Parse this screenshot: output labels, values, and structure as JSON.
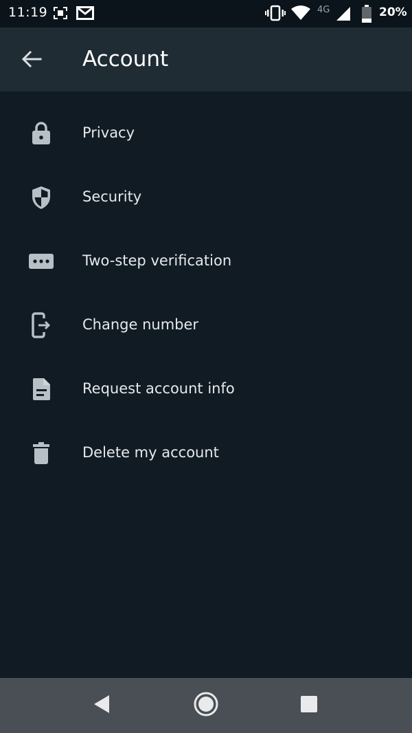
{
  "status_bar": {
    "time": "11:19",
    "network_type": "4G",
    "battery_percent": "20%",
    "icons": [
      "screenshot-icon",
      "gmail-icon",
      "vibrate-icon",
      "wifi-icon",
      "signal-icon",
      "battery-icon"
    ]
  },
  "app_bar": {
    "title": "Account",
    "back_icon": "arrow-left-icon"
  },
  "menu": {
    "items": [
      {
        "label": "Privacy",
        "icon": "lock-icon"
      },
      {
        "label": "Security",
        "icon": "shield-icon"
      },
      {
        "label": "Two-step verification",
        "icon": "dots-password-icon"
      },
      {
        "label": "Change number",
        "icon": "phone-exit-icon"
      },
      {
        "label": "Request account info",
        "icon": "document-icon"
      },
      {
        "label": "Delete my account",
        "icon": "trash-icon"
      }
    ]
  },
  "nav_bar": {
    "icons": [
      "nav-back-icon",
      "nav-home-icon",
      "nav-recents-icon"
    ]
  },
  "colors": {
    "background": "#111b24",
    "app_bar": "#1f2c34",
    "status_bar": "#0b141b",
    "nav_bar": "#4a4f55",
    "icon": "#b7c0c6",
    "text": "#e6e9eb"
  }
}
